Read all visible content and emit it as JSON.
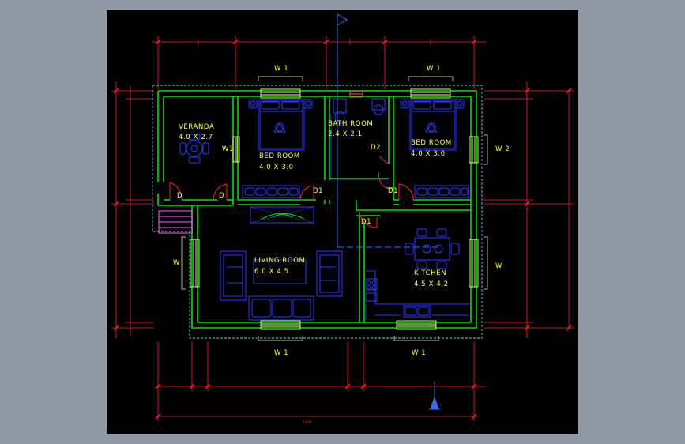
{
  "colors": {
    "canvas": "#000000",
    "outside": "#8f98a4",
    "wall": "#00e000",
    "furniture": "#2a3cff",
    "label": "#ffff40",
    "dimension": "#ff2020",
    "door_swing": "#ff2020",
    "window": "#ffffa0",
    "outer_line": "#40e0e0",
    "stair": "#ff60ff"
  },
  "rooms": {
    "veranda": {
      "name": "VERANDA",
      "size": "4.0 X 2.7"
    },
    "bedroom_left": {
      "name": "BED ROOM",
      "size": "4.0 X 3.0"
    },
    "bathroom": {
      "name": "BATH ROOM",
      "size": "2.4 X 2.1"
    },
    "bedroom_right": {
      "name": "BED ROOM",
      "size": "4.0 X 3.0"
    },
    "living": {
      "name": "LIVING ROOM",
      "size": "6.0 X 4.5"
    },
    "kitchen": {
      "name": "KITCHEN",
      "size": "4.5 X 4.2"
    }
  },
  "tags": {
    "w1_top_left": "W 1",
    "w1_top_right": "W 1",
    "w1_bottom_left": "W 1",
    "w1_bottom_right": "W 1",
    "w1_bedroom": "W1",
    "w2_right": "W 2",
    "w_left": "W",
    "w_right": "W",
    "d_veranda_1": "D",
    "d_veranda_2": "D",
    "d1_bed_left": "D1",
    "d1_bed_right": "D1",
    "d2_bath": "D2",
    "d1_kitchen": "D1"
  },
  "dimensions": {
    "overall_bottom": "13.40"
  }
}
